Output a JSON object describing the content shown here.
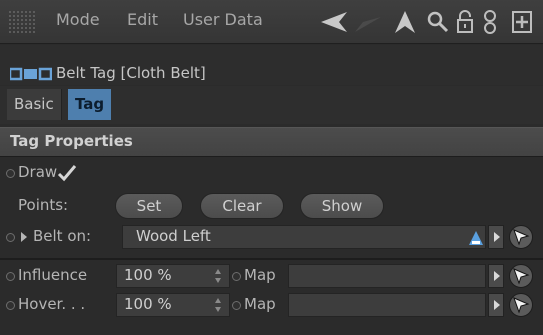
{
  "menu": {
    "mode": "Mode",
    "edit": "Edit",
    "user_data": "User Data"
  },
  "toolbar_icons": [
    "back-arrow-icon",
    "forward-arrow-icon",
    "up-arrow-icon",
    "search-icon",
    "lock-icon",
    "link-icon",
    "add-panel-icon"
  ],
  "tag": {
    "title": "Belt Tag [Cloth Belt]",
    "icon": "belt-tag-icon"
  },
  "tabs": [
    {
      "label": "Basic",
      "active": false
    },
    {
      "label": "Tag",
      "active": true
    }
  ],
  "section": {
    "title": "Tag Properties"
  },
  "draw": {
    "label": "Draw",
    "checked": true
  },
  "points": {
    "label": "Points:",
    "set_label": "Set",
    "clear_label": "Clear",
    "show_label": "Show"
  },
  "belt_on": {
    "label": "Belt on:",
    "value": "Wood Left"
  },
  "influence": {
    "label": "Influence",
    "value": "100 %",
    "map_label": "Map",
    "map_value": ""
  },
  "hover": {
    "label": "Hover. . .",
    "value": "100 %",
    "map_label": "Map",
    "map_value": ""
  },
  "colors": {
    "accent": "#4e7fae",
    "background": "#2b2b2b"
  }
}
